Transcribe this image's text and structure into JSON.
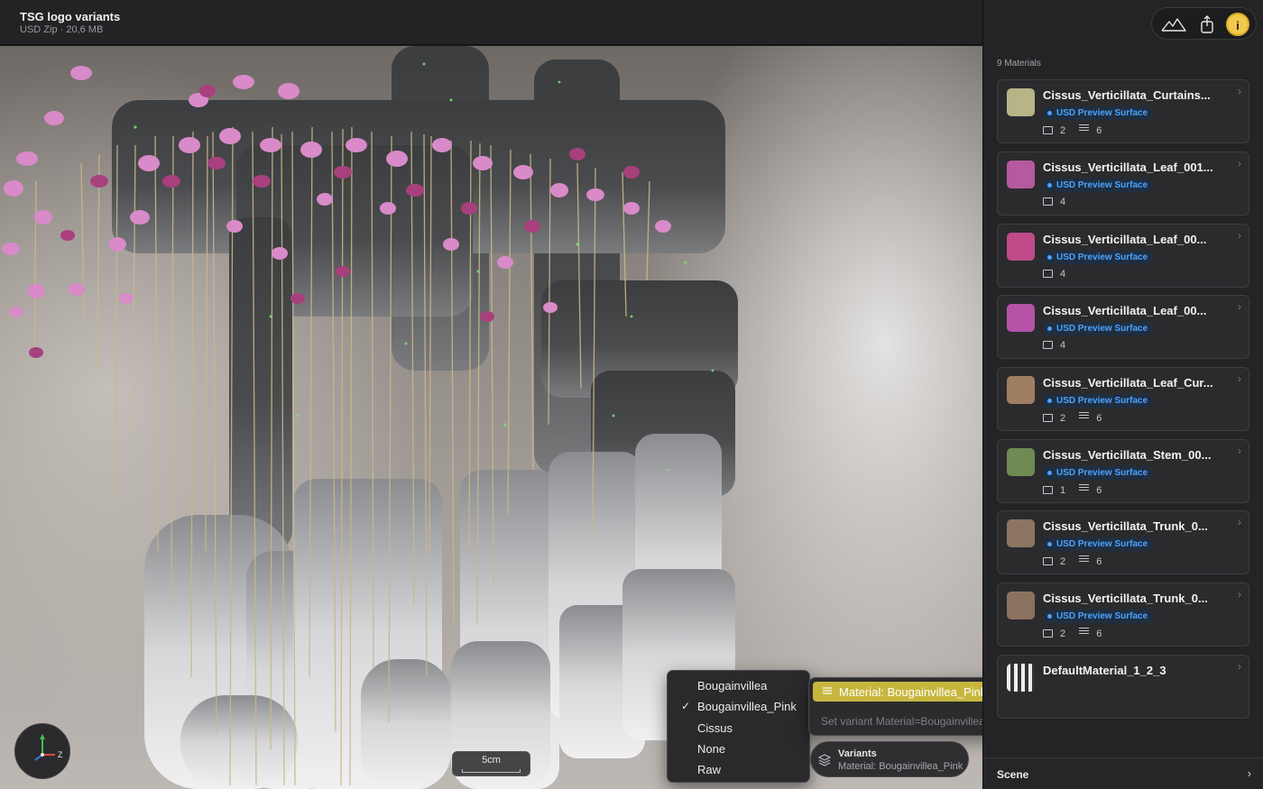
{
  "window": {
    "title": "TSG logo variants",
    "subtitle": "USD Zip · 20,6 MB"
  },
  "toolbar": {
    "buttons": [
      {
        "name": "mountains-icon"
      },
      {
        "name": "share-icon"
      },
      {
        "name": "info-icon",
        "label": "i"
      }
    ]
  },
  "viewport": {
    "scale_label": "5cm",
    "gizmo_axes": [
      "y",
      "x",
      "z"
    ],
    "gizmo_z_label": "Z"
  },
  "sidebar": {
    "material_count": "9 Materials",
    "materials": [
      {
        "name": "Cissus_Verticillata_Curtains...",
        "badge": "USD Preview Surface",
        "textures": "2",
        "params": "6",
        "swatch": "#b7b487"
      },
      {
        "name": "Cissus_Verticillata_Leaf_001...",
        "badge": "USD Preview Surface",
        "textures": "4",
        "params": "",
        "swatch": "#b55aa0"
      },
      {
        "name": "Cissus_Verticillata_Leaf_00...",
        "badge": "USD Preview Surface",
        "textures": "4",
        "params": "",
        "swatch": "#c04a8a"
      },
      {
        "name": "Cissus_Verticillata_Leaf_00...",
        "badge": "USD Preview Surface",
        "textures": "4",
        "params": "",
        "swatch": "#b453a6"
      },
      {
        "name": "Cissus_Verticillata_Leaf_Cur...",
        "badge": "USD Preview Surface",
        "textures": "2",
        "params": "6",
        "swatch": "#a07e62"
      },
      {
        "name": "Cissus_Verticillata_Stem_00...",
        "badge": "USD Preview Surface",
        "textures": "1",
        "params": "6",
        "swatch": "#6f8a52"
      },
      {
        "name": "Cissus_Verticillata_Trunk_0...",
        "badge": "USD Preview Surface",
        "textures": "2",
        "params": "6",
        "swatch": "#8c7563"
      },
      {
        "name": "Cissus_Verticillata_Trunk_0...",
        "badge": "USD Preview Surface",
        "textures": "2",
        "params": "6",
        "swatch": "#8a725e"
      },
      {
        "name": "DefaultMaterial_1_2_3",
        "badge": "",
        "textures": "",
        "params": "",
        "swatch": "#cfcfcf"
      }
    ],
    "scene_label": "Scene"
  },
  "variant_menu": {
    "items": [
      {
        "label": "Bougainvillea",
        "checked": false
      },
      {
        "label": "Bougainvillea_Pink",
        "checked": true
      },
      {
        "label": "Cissus",
        "checked": false
      },
      {
        "label": "None",
        "checked": false
      },
      {
        "label": "Raw",
        "checked": false
      }
    ],
    "check_glyph": "✓"
  },
  "command": {
    "selected": "Material: Bougainvillea_Pink",
    "hint": "Set variant Material=Bougainvillea_Pink on /Root staged."
  },
  "variants_pill": {
    "title": "Variants",
    "value": "Material: Bougainvillea_Pink"
  },
  "colors": {
    "accent_yellow": "#c7b63e",
    "info_yellow": "#f2c94c",
    "badge_blue": "#4aa3ff"
  }
}
